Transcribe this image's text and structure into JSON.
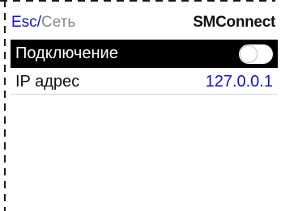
{
  "header": {
    "back_label": "Esc",
    "separator": "/",
    "current_page": "Сеть",
    "app_name": "SMConnect"
  },
  "settings": {
    "connection": {
      "label": "Подключение",
      "enabled": false
    },
    "ip": {
      "label": "IP адрес",
      "value": "127.0.0.1"
    }
  },
  "colors": {
    "link": "#1111cc",
    "selected_row_bg": "#000000",
    "muted_text": "#888888"
  }
}
